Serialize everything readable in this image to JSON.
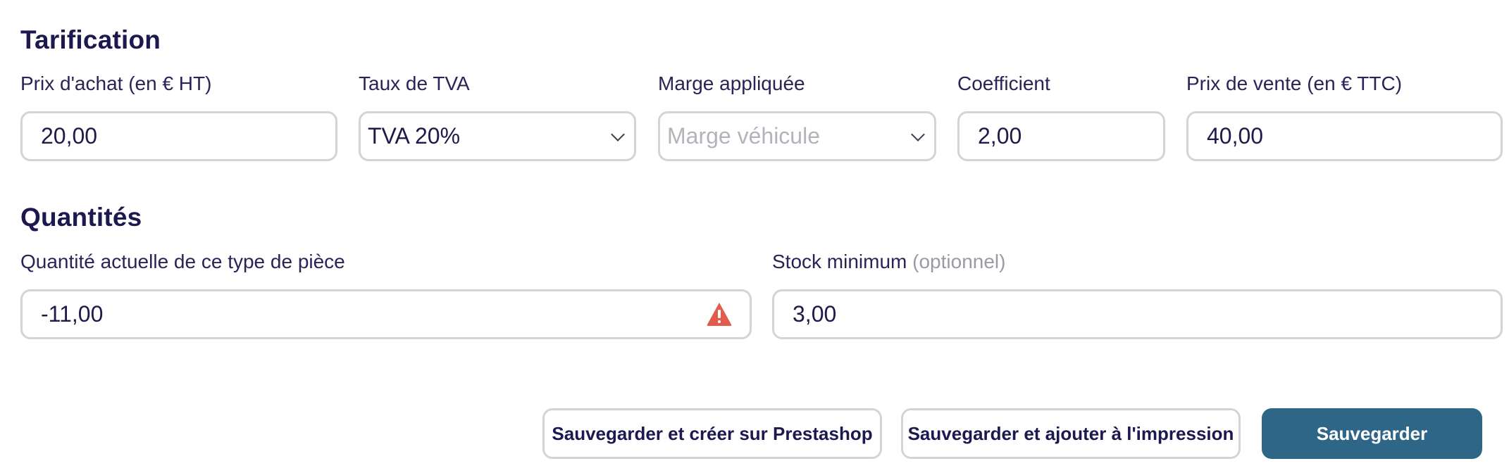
{
  "pricing": {
    "title": "Tarification",
    "purchase_price": {
      "label": "Prix d'achat (en € HT)",
      "value": "20,00"
    },
    "vat_rate": {
      "label": "Taux de TVA",
      "value": "TVA 20%"
    },
    "margin": {
      "label": "Marge appliquée",
      "placeholder": "Marge véhicule"
    },
    "coefficient": {
      "label": "Coefficient",
      "value": "2,00"
    },
    "sale_price": {
      "label": "Prix de vente (en € TTC)",
      "value": "40,00"
    }
  },
  "quantities": {
    "title": "Quantités",
    "current_qty": {
      "label": "Quantité actuelle de ce type de pièce",
      "value": "-11,00",
      "warning_icon": "warning-triangle-icon",
      "warning_color": "#e25c4c"
    },
    "min_stock": {
      "label": "Stock minimum",
      "optional_label": "(optionnel)",
      "value": "3,00"
    }
  },
  "actions": {
    "save_prestashop": "Sauvegarder et créer sur Prestashop",
    "save_print": "Sauvegarder et ajouter à l'impression",
    "save": "Sauvegarder",
    "primary_color": "#2d6687"
  }
}
